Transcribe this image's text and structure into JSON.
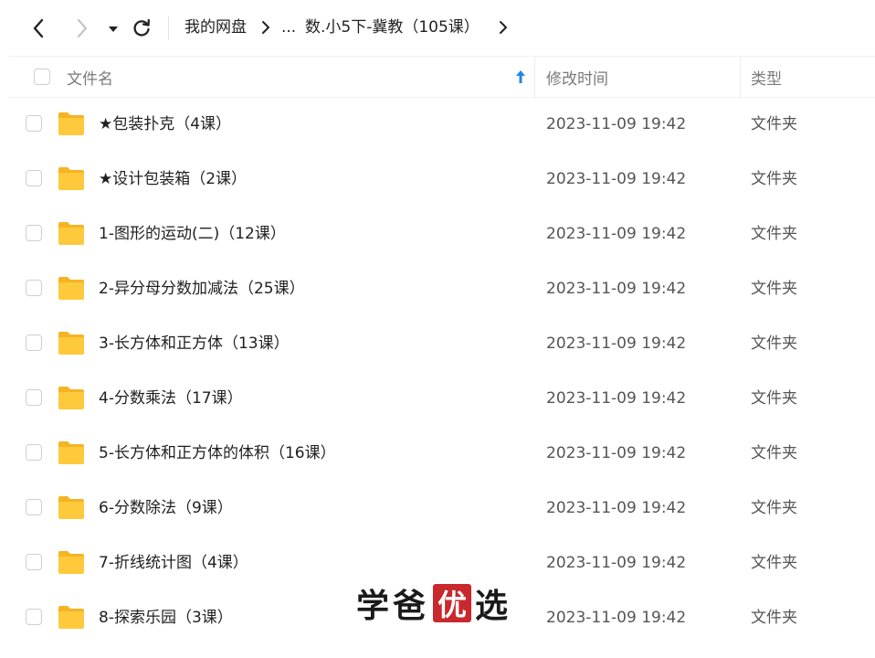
{
  "toolbar": {
    "breadcrumb": {
      "root": "我的网盘",
      "ellipsis": "...",
      "current": "数.小5下-冀教（105课）"
    }
  },
  "table": {
    "columns": {
      "name": "文件名",
      "modified": "修改时间",
      "type": "类型"
    },
    "sort": {
      "column": "name",
      "direction": "ascending"
    },
    "rows": [
      {
        "name": "★包装扑克（4课）",
        "modified": "2023-11-09 19:42",
        "type": "文件夹"
      },
      {
        "name": "★设计包装箱（2课）",
        "modified": "2023-11-09 19:42",
        "type": "文件夹"
      },
      {
        "name": "1-图形的运动(二)（12课）",
        "modified": "2023-11-09 19:42",
        "type": "文件夹"
      },
      {
        "name": "2-异分母分数加减法（25课）",
        "modified": "2023-11-09 19:42",
        "type": "文件夹"
      },
      {
        "name": "3-长方体和正方体（13课）",
        "modified": "2023-11-09 19:42",
        "type": "文件夹"
      },
      {
        "name": "4-分数乘法（17课）",
        "modified": "2023-11-09 19:42",
        "type": "文件夹"
      },
      {
        "name": "5-长方体和正方体的体积（16课）",
        "modified": "2023-11-09 19:42",
        "type": "文件夹"
      },
      {
        "name": "6-分数除法（9课）",
        "modified": "2023-11-09 19:42",
        "type": "文件夹"
      },
      {
        "name": "7-折线统计图（4课）",
        "modified": "2023-11-09 19:42",
        "type": "文件夹"
      },
      {
        "name": "8-探索乐园（3课）",
        "modified": "2023-11-09 19:42",
        "type": "文件夹"
      }
    ]
  },
  "watermark": {
    "part1": "学爸",
    "stamp": "优",
    "part2": "选"
  },
  "colors": {
    "folder": "#FFC93C",
    "folder_tab": "#F5B422",
    "sort_arrow": "#1E88E5",
    "stamp": "#C9282D"
  }
}
